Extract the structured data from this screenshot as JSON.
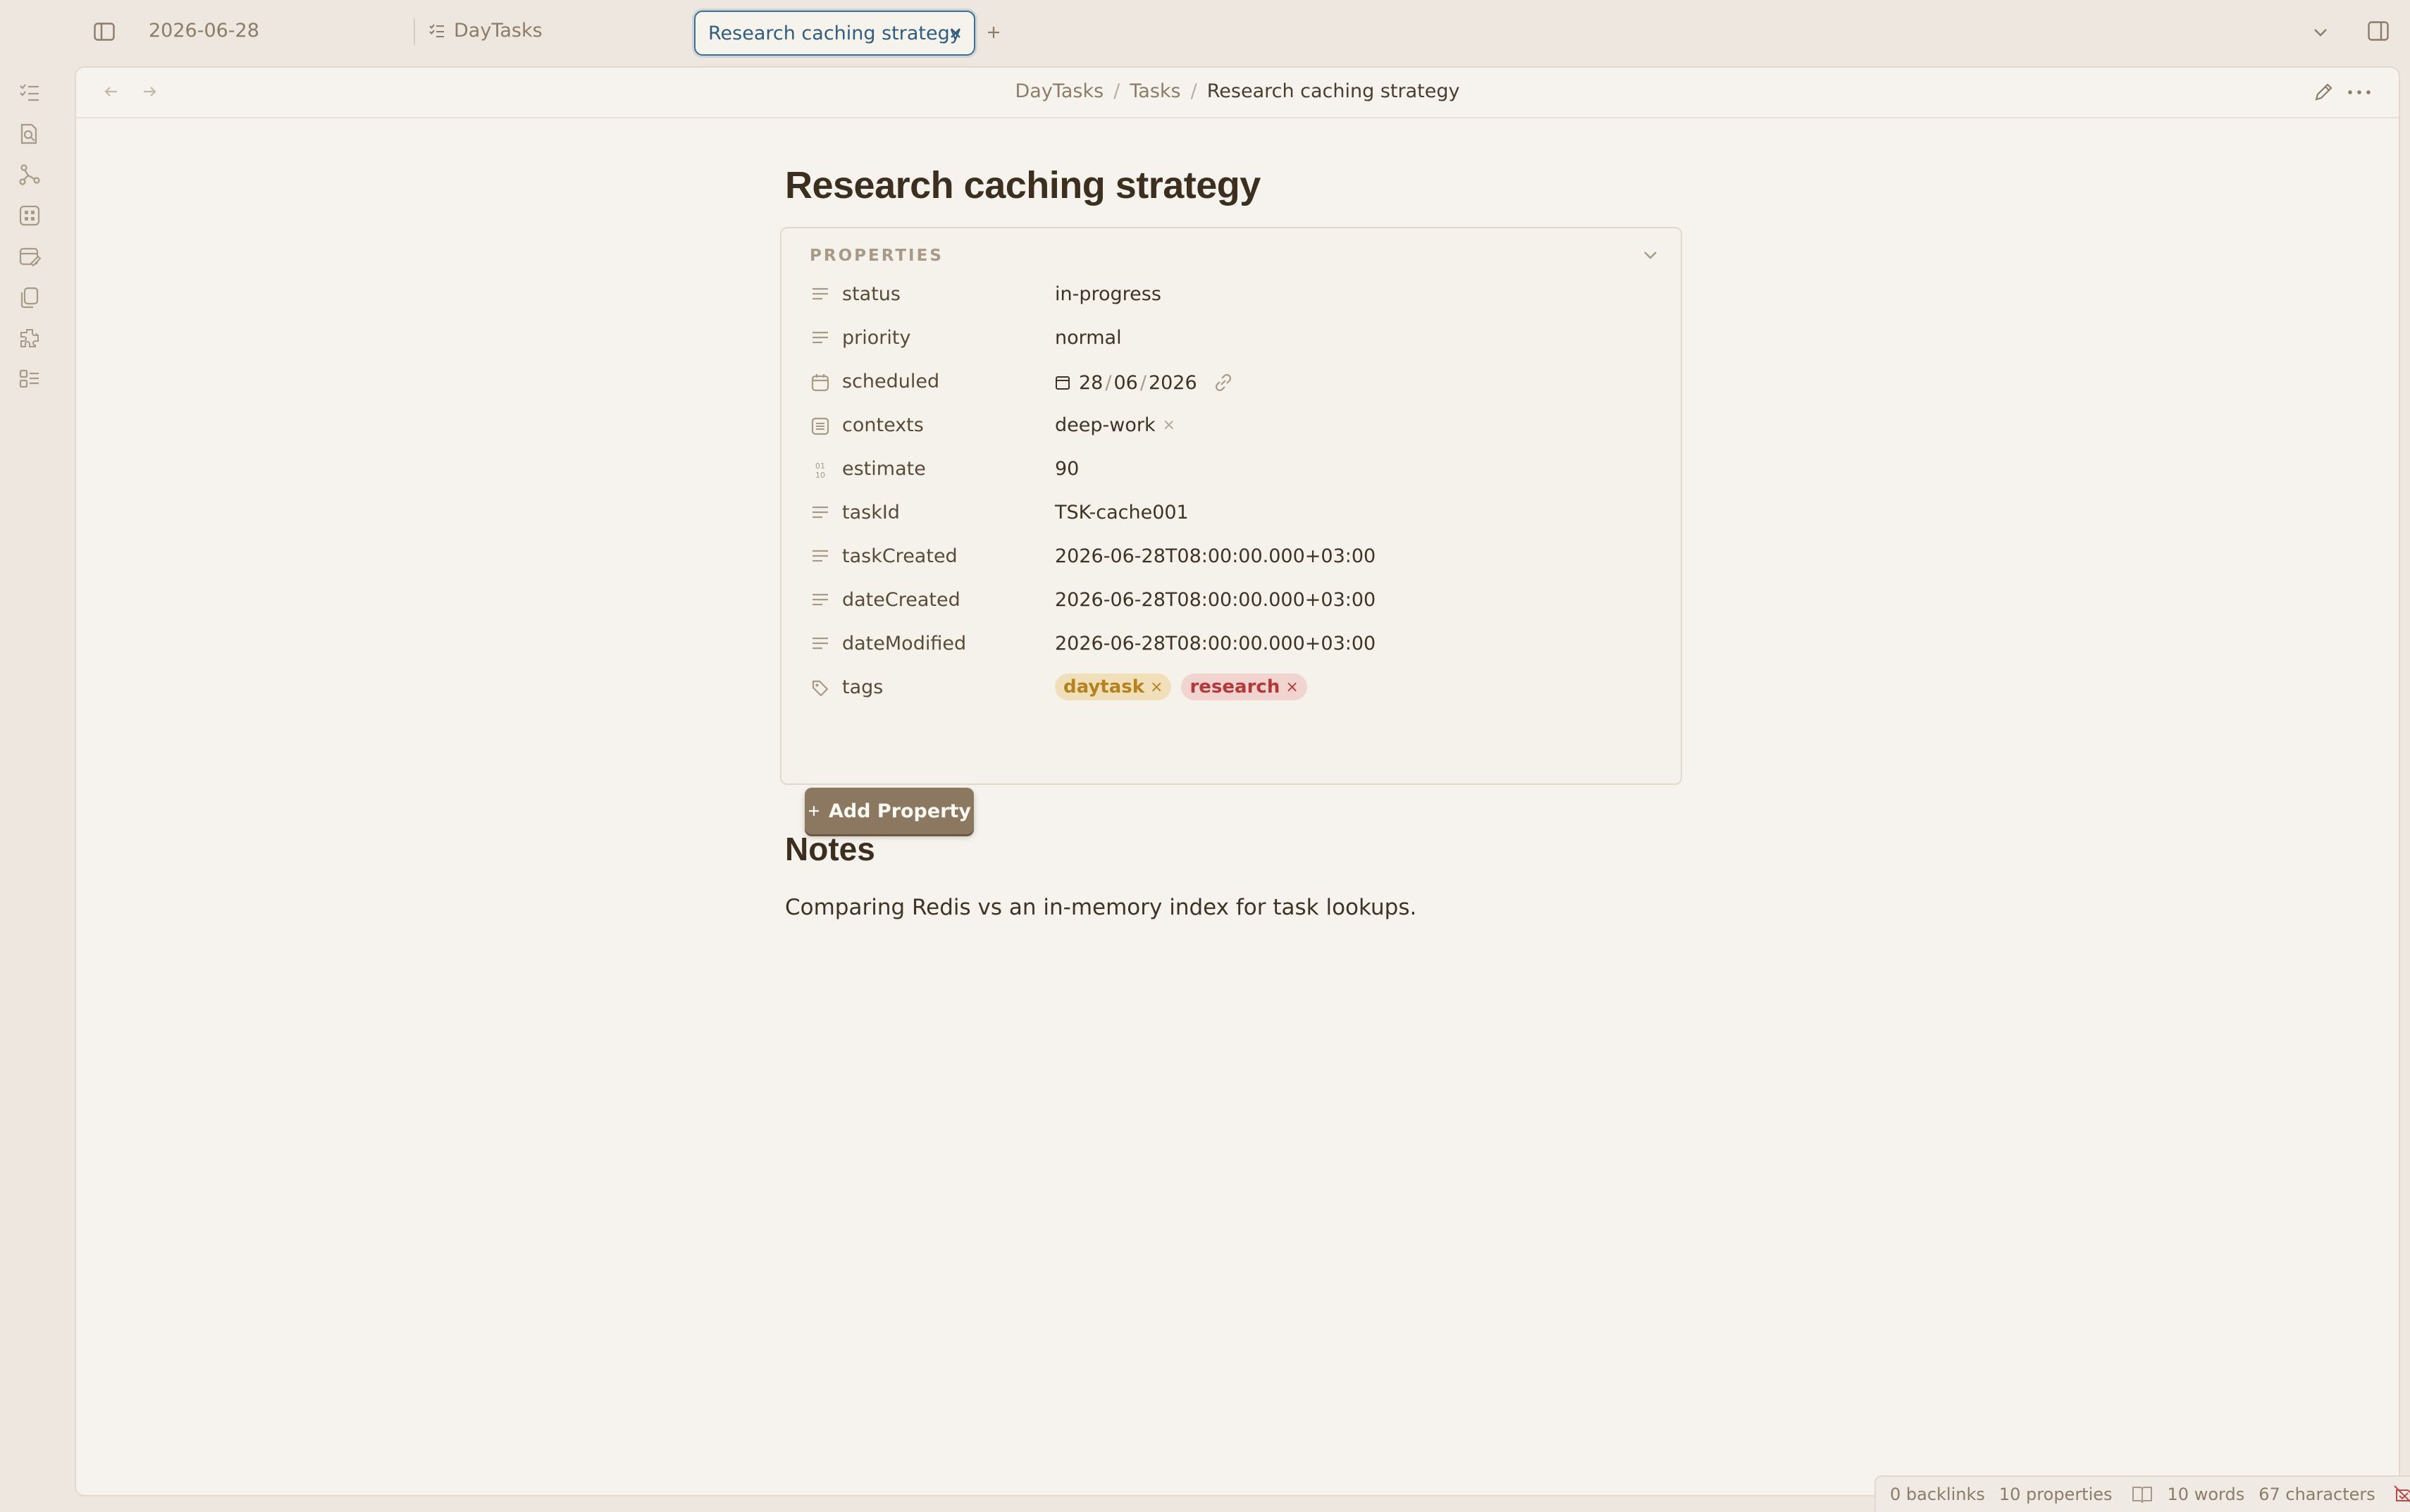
{
  "tabs": [
    {
      "label": "2026-06-28"
    },
    {
      "label": "DayTasks"
    },
    {
      "label": "Research caching strategy",
      "active": true
    }
  ],
  "breadcrumb": {
    "items": [
      "DayTasks",
      "Tasks"
    ],
    "current": "Research caching strategy",
    "separator": "/"
  },
  "note": {
    "title": "Research caching strategy",
    "notes_heading": "Notes",
    "notes_body": "Comparing Redis vs an in-memory index for task lookups."
  },
  "properties": {
    "heading": "PROPERTIES",
    "rows": [
      {
        "key": "status",
        "value": "in-progress",
        "icon": "text-lines-icon"
      },
      {
        "key": "priority",
        "value": "normal",
        "icon": "text-lines-icon"
      },
      {
        "key": "scheduled",
        "date": {
          "day": "28",
          "month": "06",
          "year": "2026"
        },
        "icon": "calendar-icon"
      },
      {
        "key": "contexts",
        "value": "deep-work",
        "icon": "list-icon"
      },
      {
        "key": "estimate",
        "value": "90",
        "icon": "number-icon"
      },
      {
        "key": "taskId",
        "value": "TSK-cache001",
        "icon": "text-lines-icon"
      },
      {
        "key": "taskCreated",
        "value": "2026-06-28T08:00:00.000+03:00",
        "icon": "text-lines-icon"
      },
      {
        "key": "dateCreated",
        "value": "2026-06-28T08:00:00.000+03:00",
        "icon": "text-lines-icon"
      },
      {
        "key": "dateModified",
        "value": "2026-06-28T08:00:00.000+03:00",
        "icon": "text-lines-icon"
      },
      {
        "key": "tags",
        "tags": [
          "daytask",
          "research"
        ],
        "icon": "tag-icon"
      }
    ],
    "add_label": "Add Property",
    "remove_glyph": "×"
  },
  "statusbar": {
    "backlinks": "0 backlinks",
    "properties": "10 properties",
    "words": "10 words",
    "characters": "67 characters"
  },
  "colors": {
    "accent": "#3b6f94",
    "tag_daytask": "#b5821d",
    "tag_research": "#b4393a",
    "button": "#8c7761"
  }
}
